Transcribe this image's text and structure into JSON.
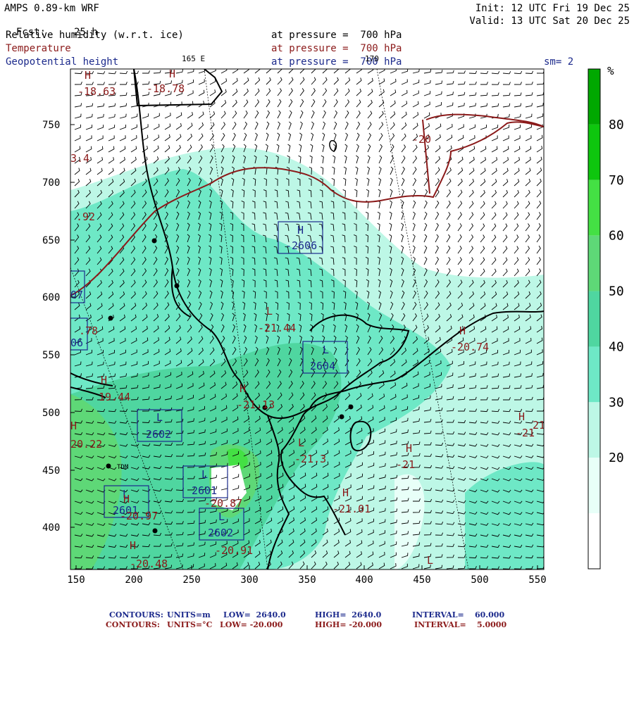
{
  "header": {
    "model": "AMPS 0.89-km WRF",
    "fcst_label": "Fcst:",
    "fcst_value": "25 h",
    "init": "Init: 12 UTC Fri 19 Dec 25",
    "valid": "Valid: 13 UTC Sat 20 Dec 25",
    "field1_name": "Relative humidity (w.r.t. ice)",
    "field1_level": "at pressure =  700 hPa",
    "field2_name": "Temperature",
    "field2_level": "at pressure =  700 hPa",
    "field3_name": "Geopotential height",
    "field3_level": "at pressure =  700 hPa",
    "lon_label_165": "165 E",
    "lon_label_170": "170",
    "smoothing": "sm= 2"
  },
  "axes": {
    "x_ticks": [
      "150",
      "200",
      "250",
      "300",
      "350",
      "400",
      "450",
      "500",
      "550"
    ],
    "y_ticks": [
      "750",
      "700",
      "650",
      "600",
      "550",
      "500",
      "450",
      "400"
    ]
  },
  "colorbar": {
    "unit": "%",
    "labels": [
      "80",
      "70",
      "60",
      "50",
      "40",
      "30",
      "20"
    ],
    "colors": [
      "#ffffff",
      "#e8fff8",
      "#bdf7e6",
      "#6ee8c6",
      "#4fd6a0",
      "#5ed877",
      "#44e044",
      "#0ec60e",
      "#00a800"
    ]
  },
  "map_labels": {
    "height_H": [
      {
        "letter": "H",
        "value": "-2606"
      }
    ],
    "height_L": [
      {
        "letter": "L",
        "value": "2604"
      },
      {
        "letter": "L",
        "value": "2602"
      },
      {
        "letter": "L",
        "value": "2601"
      },
      {
        "letter": "L",
        "value": "2601"
      },
      {
        "letter": "L",
        "value": "2602"
      }
    ],
    "partial_blue": [
      "07",
      "06"
    ],
    "temperature": [
      {
        "letter": "H",
        "value": "-18.63"
      },
      {
        "letter": "H",
        "value": "-18.78"
      },
      {
        "letter": "",
        "value": "3.4"
      },
      {
        "letter": "",
        "value": ".92"
      },
      {
        "letter": "",
        "value": ".78"
      },
      {
        "letter": "L",
        "value": "-21.44"
      },
      {
        "letter": "H",
        "value": "-20.74"
      },
      {
        "letter": "H",
        "value": "19.44"
      },
      {
        "letter": "H",
        "value": "20.22"
      },
      {
        "letter": "H",
        "value": "-21.13"
      },
      {
        "letter": "H",
        "value": "-21"
      },
      {
        "letter": "H",
        "value": "-21"
      },
      {
        "letter": "H",
        "value": "-20.97"
      },
      {
        "letter": "",
        "value": "-20.87"
      },
      {
        "letter": "",
        "value": "-20.91"
      },
      {
        "letter": "H",
        "value": "-20.48"
      },
      {
        "letter": "",
        "value": "-20"
      },
      {
        "letter": "H",
        "value": "-21.01"
      },
      {
        "letter": "L",
        "value": "-21.3"
      },
      {
        "letter": "L",
        "value": ""
      },
      {
        "letter": "",
        "value": "21"
      }
    ],
    "station_label": "TDM"
  },
  "footer": {
    "line1_label": "CONTOURS:",
    "line1_units": "UNITS=m",
    "line1_low": "LOW=  2640.0",
    "line1_high": "HIGH=  2640.0",
    "line1_interval": "INTERVAL=    60.000",
    "line2_label": "CONTOURS:",
    "line2_units": "UNITS=°C",
    "line2_low": "LOW= -20.000",
    "line2_high": "HIGH= -20.000",
    "line2_interval": "INTERVAL=    5.0000"
  }
}
